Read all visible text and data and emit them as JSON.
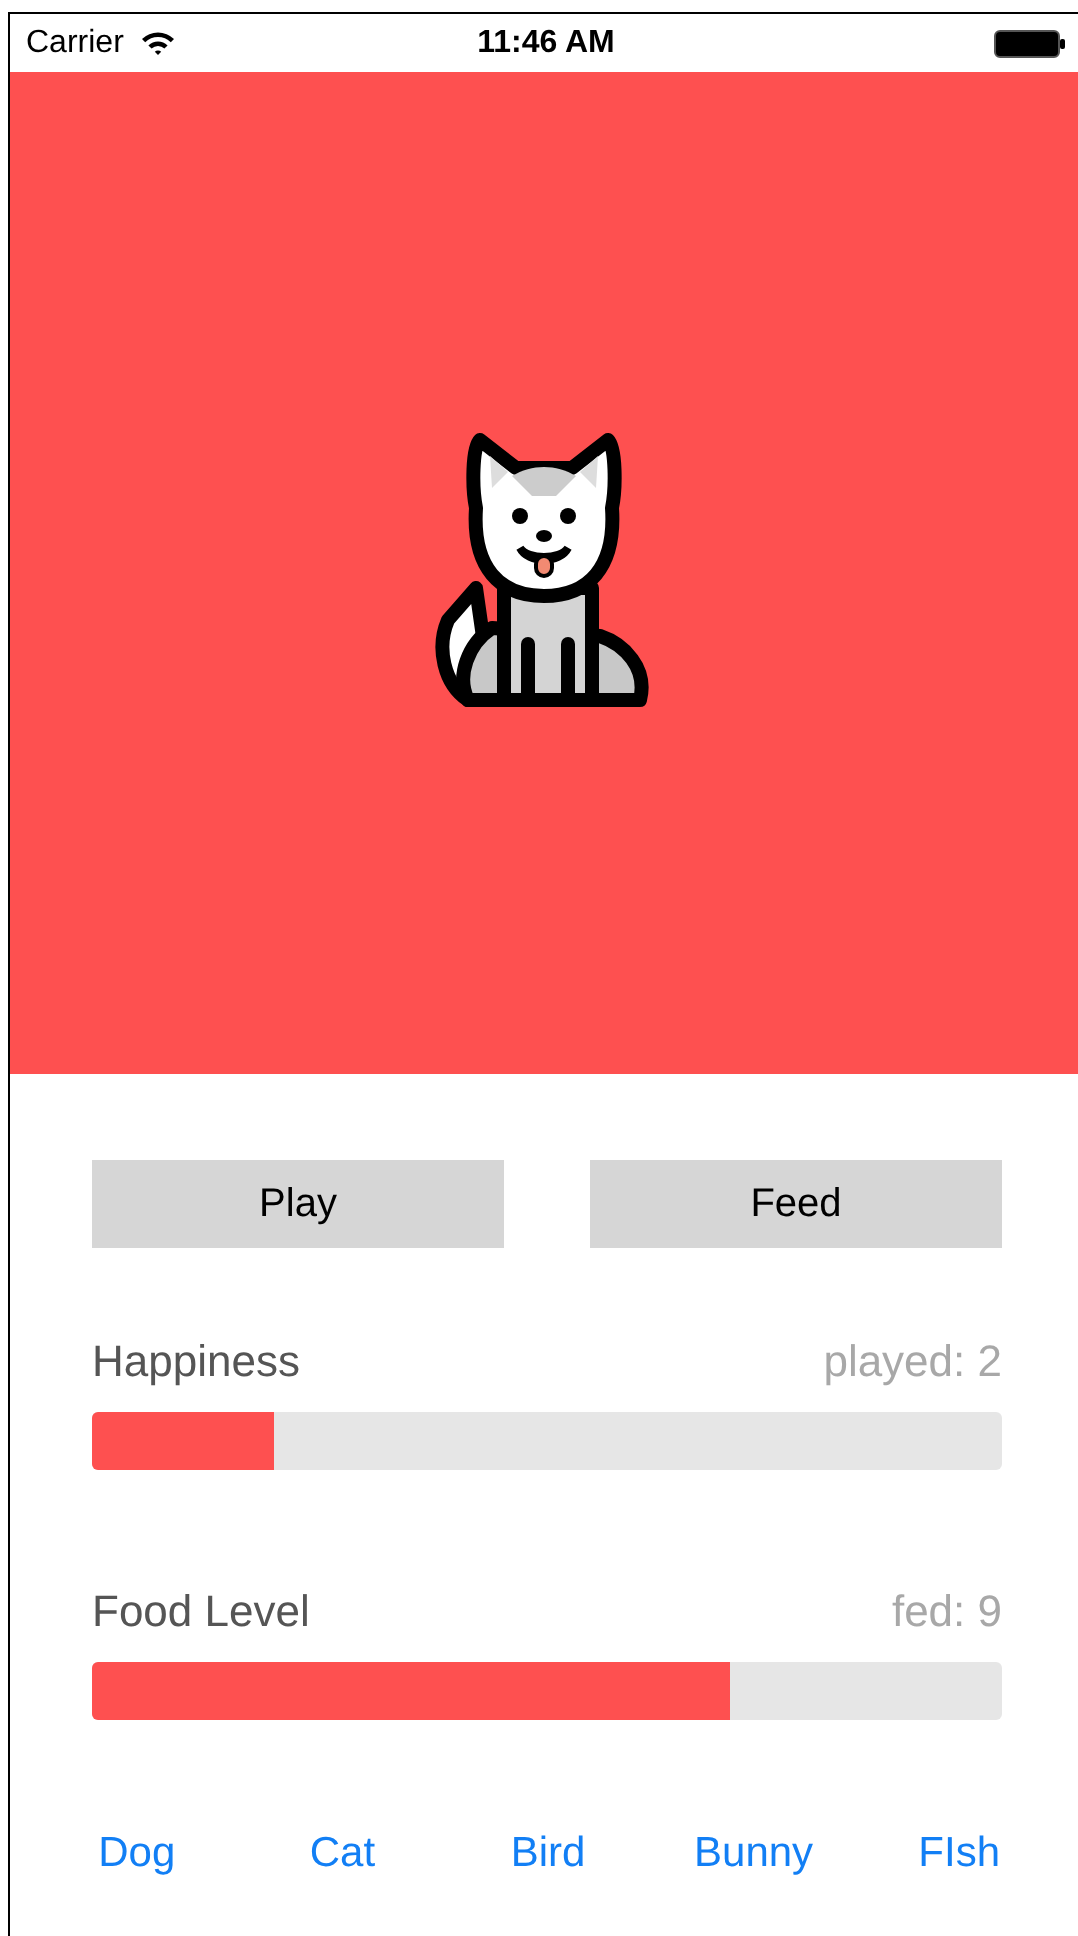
{
  "status_bar": {
    "carrier": "Carrier",
    "time": "11:46 AM"
  },
  "pet": {
    "kind": "dog"
  },
  "actions": [
    "Play",
    "Feed"
  ],
  "meters": [
    {
      "label": "Happiness",
      "reading": "played: 2",
      "level": 0.2
    },
    {
      "label": "Food Level",
      "reading": "fed: 9",
      "level": 0.7
    }
  ],
  "pet_tabs": [
    "Dog",
    "Cat",
    "Bird",
    "Bunny",
    "FIsh"
  ]
}
